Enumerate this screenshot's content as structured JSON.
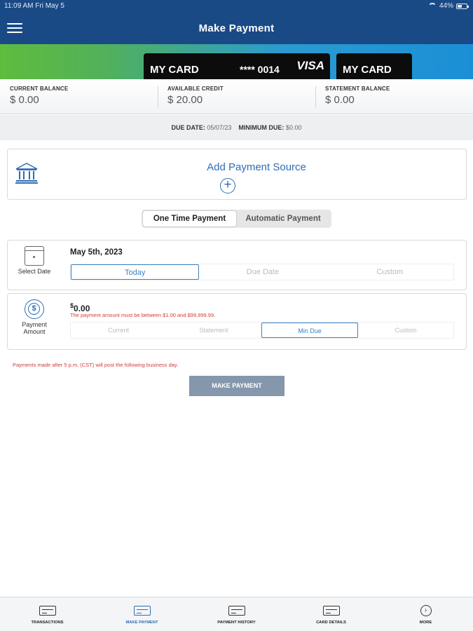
{
  "status_bar": {
    "time": "11:09 AM  Fri May 5",
    "battery": "44%"
  },
  "header": {
    "title": "Make Payment"
  },
  "cards": [
    {
      "name": "MY CARD",
      "number": "**** 0014",
      "brand": "VISA"
    },
    {
      "name": "MY CARD"
    }
  ],
  "balances": [
    {
      "label": "CURRENT BALANCE",
      "value": "$ 0.00"
    },
    {
      "label": "AVAILABLE CREDIT",
      "value": "$ 20.00"
    },
    {
      "label": "STATEMENT BALANCE",
      "value": "$ 0.00"
    }
  ],
  "due": {
    "due_label": "DUE DATE:",
    "due_value": "05/07/23",
    "min_label": "MINIMUM DUE:",
    "min_value": "$0.00"
  },
  "payment_source": {
    "title": "Add Payment Source"
  },
  "payment_type": {
    "options": [
      "One Time Payment",
      "Automatic Payment"
    ],
    "selected": "One Time Payment"
  },
  "date": {
    "label": "Select Date",
    "value": "May 5th, 2023",
    "options": [
      "Today",
      "Due Date",
      "Custom"
    ],
    "selected": "Today"
  },
  "amount": {
    "label": "Payment Amount",
    "currency": "$",
    "value": "0.00",
    "error": "The payment amount must be between $1.00 and $99,999.99.",
    "options": [
      "Current",
      "Statement",
      "Min Due",
      "Custom"
    ],
    "selected": "Min Due"
  },
  "notice": "Payments made after 5 p.m. (CST) will post the following business day.",
  "submit": {
    "label": "MAKE PAYMENT"
  },
  "tabs": [
    {
      "label": "TRANSACTIONS",
      "icon": "transactions-icon"
    },
    {
      "label": "MAKE PAYMENT",
      "icon": "make-payment-icon",
      "active": true
    },
    {
      "label": "PAYMENT HISTORY",
      "icon": "payment-history-icon"
    },
    {
      "label": "CARD DETAILS",
      "icon": "card-details-icon"
    },
    {
      "label": "MORE",
      "icon": "more-icon"
    }
  ],
  "colors": {
    "header": "#1a4a86",
    "accent": "#2f6db3",
    "error": "#d23b3b",
    "button": "#8497ab"
  }
}
